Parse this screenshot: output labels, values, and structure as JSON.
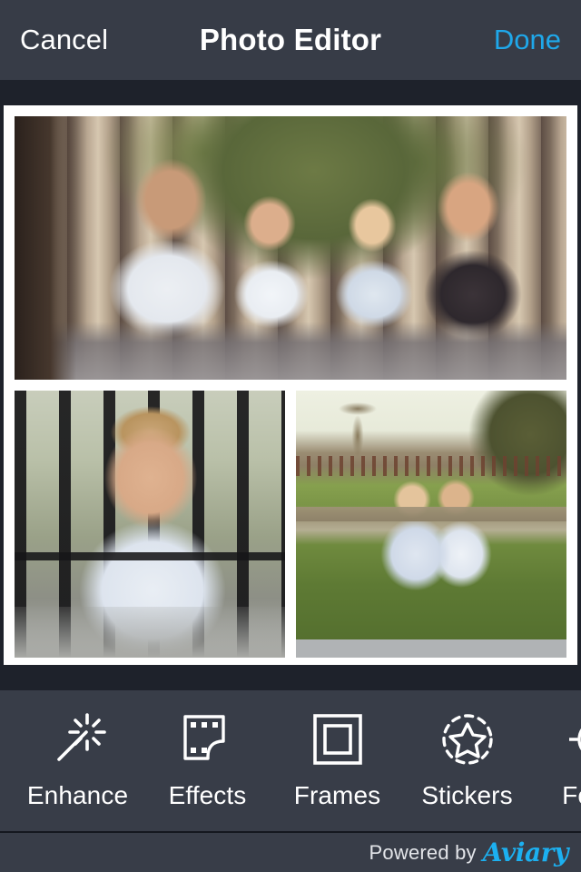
{
  "header": {
    "cancel_label": "Cancel",
    "title": "Photo Editor",
    "done_label": "Done",
    "done_color": "#1fa8ea",
    "background_color": "#373c47"
  },
  "canvas": {
    "background_color": "#1e222b",
    "frame_color": "#ffffff",
    "collage": {
      "layout": "one-panorama-top-two-below",
      "cells": [
        {
          "position": "top",
          "description": "Family of four — man, young boy, young girl and woman lying on stone steps in front of fluted columns with green foliage behind"
        },
        {
          "position": "bottom-left",
          "description": "Young boy in light blue polo shirt smiling in front of a black iron railing"
        },
        {
          "position": "bottom-right",
          "description": "Two young children hugging while sitting on green grass in a park with palm tree and hedges",
          "has_bottom_placeholder_strip": true,
          "placeholder_strip_color": "#b0b3b5"
        }
      ]
    }
  },
  "toolbar": {
    "background_color": "#383d48",
    "items": [
      {
        "id": "enhance",
        "label": "Enhance",
        "icon": "magic-wand-icon"
      },
      {
        "id": "effects",
        "label": "Effects",
        "icon": "filmstrip-icon"
      },
      {
        "id": "frames",
        "label": "Frames",
        "icon": "double-square-frame-icon"
      },
      {
        "id": "stickers",
        "label": "Stickers",
        "icon": "star-in-dashed-circle-icon"
      },
      {
        "id": "focus",
        "label": "Focus",
        "icon": "focus-radial-icon"
      }
    ]
  },
  "footer": {
    "powered_by_text": "Powered by",
    "brand": "Aviary",
    "brand_color": "#1cb0f0"
  }
}
